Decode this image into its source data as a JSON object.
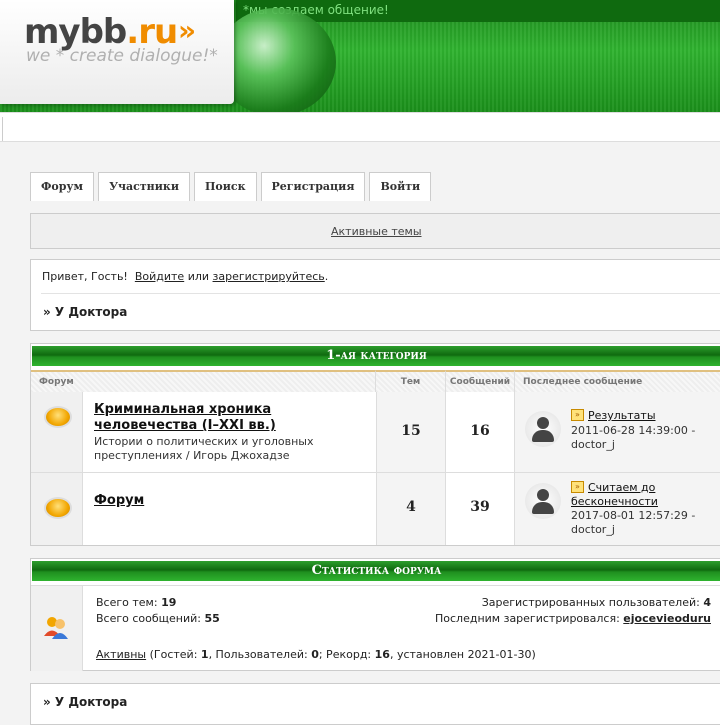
{
  "header": {
    "logo_name": "mybb",
    "logo_dot": ".ru",
    "logo_arrows": "»",
    "logo_sub": "we * create dialogue!*",
    "tagline": "*мы создаем общение!"
  },
  "nav": {
    "items": [
      "Форум",
      "Участники",
      "Поиск",
      "Регистрация",
      "Войти"
    ]
  },
  "active_topics": "Активные темы",
  "welcome": {
    "greeting": "Привет, Гость!",
    "login_link": "Войдите",
    "or_text": "или",
    "register_link": "зарегистрируйтесь",
    "period": ".",
    "breadcrumb": "» У Доктора"
  },
  "category": {
    "title": "1-ая категория",
    "columns": {
      "forum": "Форум",
      "topics": "Тем",
      "posts": "Сообщений",
      "last": "Последнее сообщение"
    },
    "forums": [
      {
        "title": "Криминальная хроника человечества (I–XXI вв.)",
        "description": "Истории о политических и уголовных преступлениях / Игорь Джохадзе",
        "topics": "15",
        "posts": "16",
        "last_title": "Результаты",
        "last_date": "2011-06-28 14:39:00 -",
        "last_author": "doctor_j"
      },
      {
        "title": "Форум",
        "description": "",
        "topics": "4",
        "posts": "39",
        "last_title": "Считаем до бесконечности",
        "last_date": "2017-08-01 12:57:29 -",
        "last_author": "doctor_j"
      }
    ]
  },
  "stats": {
    "title": "Статистика форума",
    "topics_label": "Всего тем:",
    "topics_value": "19",
    "posts_label": "Всего сообщений:",
    "posts_value": "55",
    "users_label": "Зарегистрированных пользователей:",
    "users_value": "4",
    "last_reg_label": "Последним зарегистрировался:",
    "last_reg_value": "ejocevieoduru",
    "active_link": "Активны",
    "active_guests_label": "(Гостей:",
    "active_guests": "1",
    "active_users_label": ", Пользователей:",
    "active_users": "0",
    "active_record_label": "; Рекорд:",
    "active_record": "16",
    "active_date_label": ", установлен",
    "active_date": "2021-01-30",
    "active_close": ")"
  },
  "footer_breadcrumb": "» У Доктора",
  "colors": {
    "accent_green": "#1a8f1a",
    "logo_orange": "#f08c00"
  }
}
